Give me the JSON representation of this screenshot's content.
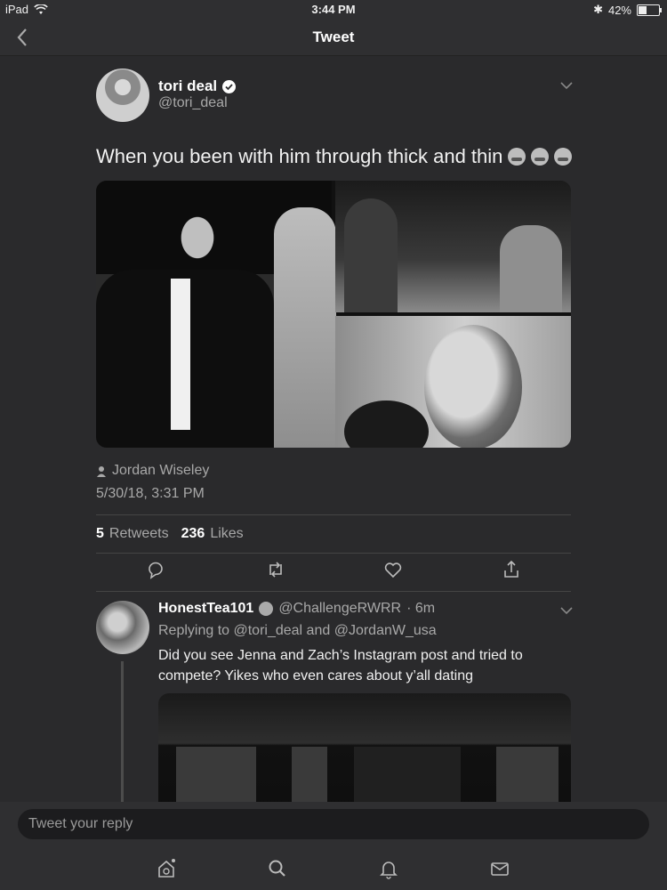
{
  "status": {
    "device": "iPad",
    "time": "3:44 PM",
    "battery": "42%"
  },
  "nav": {
    "title": "Tweet"
  },
  "tweet": {
    "author_name": "tori deal",
    "author_handle": "@tori_deal",
    "text": "When you been with him through thick and thin",
    "emojis": [
      "laughing-emoji",
      "man-emoji",
      "man-emoji"
    ],
    "location": "Jordan Wiseley",
    "timestamp": "5/30/18, 3:31 PM",
    "retweets_count": "5",
    "retweets_label": "Retweets",
    "likes_count": "236",
    "likes_label": "Likes"
  },
  "reply": {
    "author_name": "HonestTea101",
    "author_handle": "@ChallengeRWRR",
    "time_ago": "· 6m",
    "replying_to": "Replying to @tori_deal and @JordanW_usa",
    "text": "Did you see Jenna and Zach’s Instagram post and tried to compete? Yikes who even cares about y’all dating"
  },
  "composer": {
    "placeholder": "Tweet your reply"
  },
  "tabbar": {
    "items": [
      "home-icon",
      "search-icon",
      "notifications-icon",
      "messages-icon"
    ]
  }
}
